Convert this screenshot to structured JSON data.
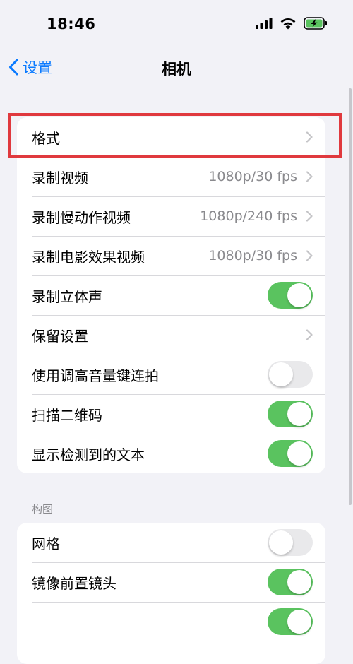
{
  "status_bar": {
    "time": "18:46",
    "icons": [
      "cellular-signal-icon",
      "wifi-icon",
      "battery-charging-icon"
    ],
    "battery_color": "#5ac35f"
  },
  "nav": {
    "back_label": "设置",
    "title": "相机"
  },
  "colors": {
    "accent": "#0a7aff",
    "toggle_on": "#5ac35f",
    "toggle_off": "#e9e9eb",
    "highlight": "#e0393e"
  },
  "group1": {
    "rows": [
      {
        "label": "格式",
        "value": "",
        "control": "chevron"
      },
      {
        "label": "录制视频",
        "value": "1080p/30 fps",
        "control": "chevron"
      },
      {
        "label": "录制慢动作视频",
        "value": "1080p/240 fps",
        "control": "chevron"
      },
      {
        "label": "录制电影效果视频",
        "value": "1080p/30 fps",
        "control": "chevron"
      },
      {
        "label": "录制立体声",
        "value": "",
        "control": "toggle",
        "on": true
      },
      {
        "label": "保留设置",
        "value": "",
        "control": "chevron"
      },
      {
        "label": "使用调高音量键连拍",
        "value": "",
        "control": "toggle",
        "on": false
      },
      {
        "label": "扫描二维码",
        "value": "",
        "control": "toggle",
        "on": true
      },
      {
        "label": "显示检测到的文本",
        "value": "",
        "control": "toggle",
        "on": true
      }
    ]
  },
  "section2": {
    "header": "构图",
    "rows": [
      {
        "label": "网格",
        "value": "",
        "control": "toggle",
        "on": false
      },
      {
        "label": "镜像前置镜头",
        "value": "",
        "control": "toggle",
        "on": true
      }
    ]
  }
}
